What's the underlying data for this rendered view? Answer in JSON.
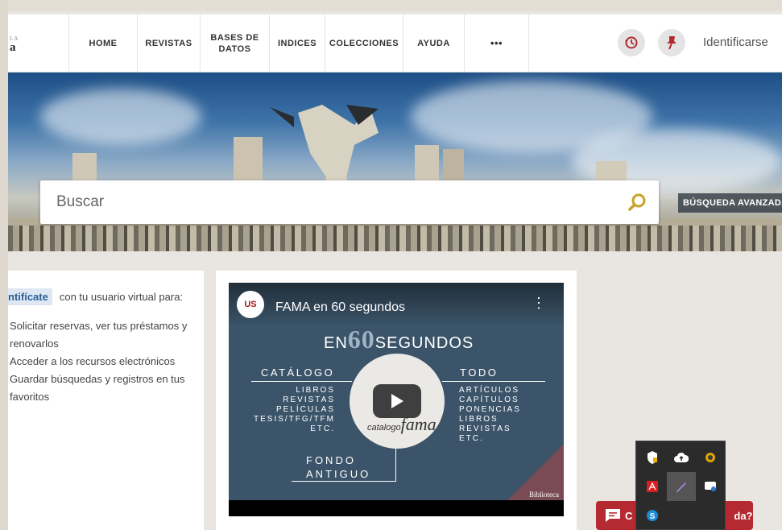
{
  "header": {
    "logo_small": "LA",
    "logo_big": "a",
    "nav": [
      {
        "label": "HOME",
        "name": "nav-home"
      },
      {
        "label": "REVISTAS",
        "name": "nav-revistas"
      },
      {
        "label": "BASES DE\nDATOS",
        "name": "nav-bases-de-datos"
      },
      {
        "label": "INDICES",
        "name": "nav-indices"
      },
      {
        "label": "COLECCIONES",
        "name": "nav-colecciones"
      },
      {
        "label": "AYUDA",
        "name": "nav-ayuda"
      },
      {
        "label": "•••",
        "name": "nav-more"
      }
    ],
    "login_label": "Identificarse",
    "history_icon": "history-icon",
    "pin_icon": "pin-icon"
  },
  "search": {
    "placeholder": "Buscar",
    "advanced_label": "BÚSQUEDA AVANZADA"
  },
  "side_panel": {
    "identify_link": "ntifícate",
    "identify_text": "con tu usuario virtual para:",
    "benefits": [
      "Solicitar reservas, ver tus préstamos y renovarlos",
      "Acceder a los recursos electrónicos",
      "Guardar búsquedas y registros en tus favoritos"
    ]
  },
  "video": {
    "channel_logo": "US",
    "title": "FAMA en 60 segundos",
    "en": "EN",
    "sixty": "60",
    "segundos": "SEGUNDOS",
    "catalogo_title": "CATÁLOGO",
    "catalogo_items": [
      "LIBROS",
      "REVISTAS",
      "PELÍCULAS",
      "TESIS/TFG/TFM",
      "ETC."
    ],
    "todo_title": "TODO",
    "todo_items": [
      "ARTÍCULOS",
      "CAPÍTULOS",
      "PONENCIAS",
      "LIBROS",
      "REVISTAS",
      "ETC."
    ],
    "brand_small": "catalogo",
    "brand_big": "fama",
    "fondo_line1": "FONDO",
    "fondo_line2": "ANTIGUO",
    "biblioteca": "Biblioteca"
  },
  "chat": {
    "label_left": "C",
    "label_right": "da?"
  },
  "tray": {
    "icons": [
      "defender-icon",
      "cloud-icon",
      "vpn-icon",
      "acrobat-icon",
      "pen-icon",
      "network-icon",
      "skype-icon"
    ]
  }
}
